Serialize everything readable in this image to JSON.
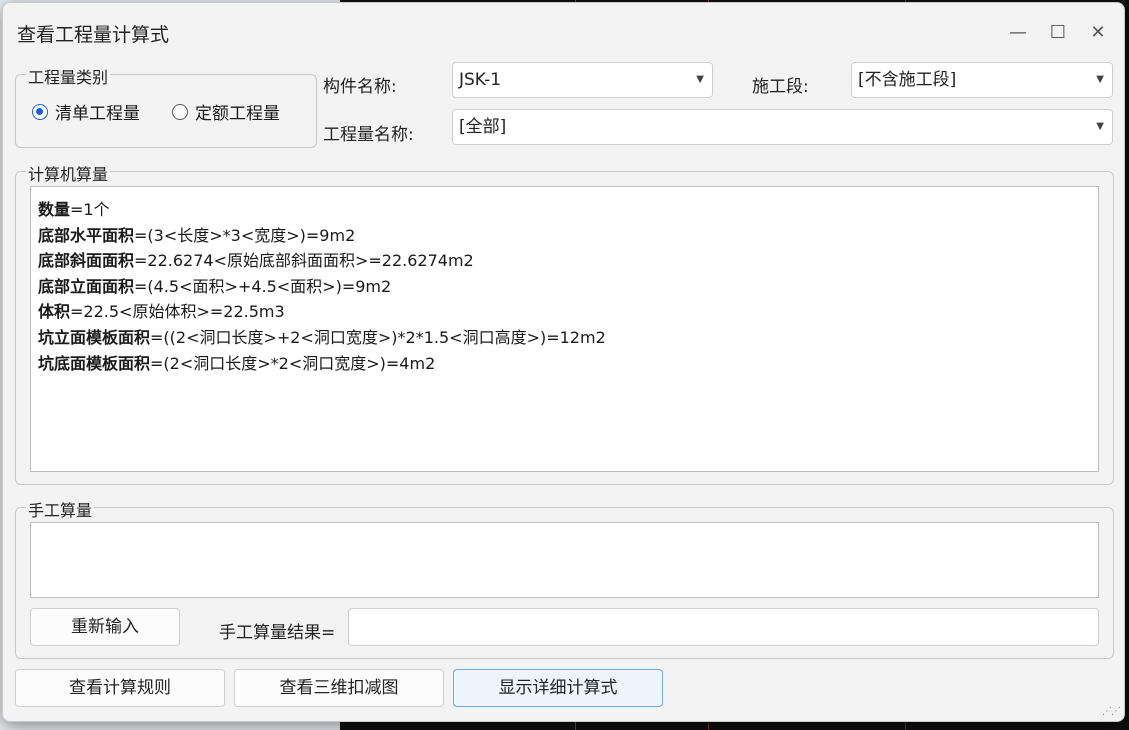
{
  "window": {
    "title": "查看工程量计算式",
    "controls": [
      "—",
      "☐",
      "✕"
    ]
  },
  "quantity_type": {
    "group_title": "工程量类别",
    "options": [
      {
        "label": "清单工程量",
        "checked": true
      },
      {
        "label": "定额工程量",
        "checked": false
      }
    ]
  },
  "component": {
    "label": "构件名称:",
    "value": "JSK-1"
  },
  "segment": {
    "label": "施工段:",
    "value": "[不含施工段]"
  },
  "quantity_name": {
    "label": "工程量名称:",
    "value": "[全部]"
  },
  "computer_calc": {
    "group_title": "计算机算量",
    "lines": [
      {
        "name": "数量",
        "expr": "=1个"
      },
      {
        "name": "底部水平面积",
        "expr": "=(3<长度>*3<宽度>)=9m2"
      },
      {
        "name": "底部斜面面积",
        "expr": "=22.6274<原始底部斜面面积>=22.6274m2"
      },
      {
        "name": "底部立面面积",
        "expr": "=(4.5<面积>+4.5<面积>)=9m2"
      },
      {
        "name": "体积",
        "expr": "=22.5<原始体积>=22.5m3"
      },
      {
        "name": "坑立面模板面积",
        "expr": "=((2<洞口长度>+2<洞口宽度>)*2*1.5<洞口高度>)=12m2"
      },
      {
        "name": "坑底面模板面积",
        "expr": "=(2<洞口长度>*2<洞口宽度>)=4m2"
      }
    ]
  },
  "manual_calc": {
    "group_title": "手工算量",
    "reinput_label": "重新输入",
    "result_label": "手工算量结果="
  },
  "bottom_buttons": {
    "rules": "查看计算规则",
    "deduction_3d": "查看三维扣减图",
    "detail": "显示详细计算式"
  },
  "colors": {
    "accent": "#1f5fd6",
    "primary_border": "#7aa7e0"
  }
}
